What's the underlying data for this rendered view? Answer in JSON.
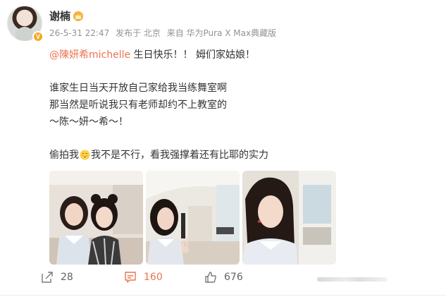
{
  "author": {
    "name": "谢楠",
    "avatar_icon": "avatar-photo",
    "badge_icon": "verified-icon",
    "badge_text": "V",
    "crown_icon": "crown-icon"
  },
  "meta": {
    "time": "26-5-31 22:47",
    "location": "发布于 北京",
    "source": "来自 华为Pura X Max典藏版"
  },
  "content": {
    "line1_mention": "@陳妍希michelle",
    "line1_text": " 生日快乐！！ 姆们家姑娘！",
    "line2": "谁家生日当天开放自己家给我当练舞室啊",
    "line3": "那当然是听说我只有老师却约不上教室的",
    "line4": "～陈～妍～希～！",
    "line5_a": "偷拍我",
    "line5_emoji": "shy-face-emoji",
    "line5_b": "我不是不行，看我强撑着还有比耶的实力"
  },
  "photos": [
    {
      "name": "photo-1",
      "alt": "two women posing in room"
    },
    {
      "name": "photo-2",
      "alt": "woman making peace sign"
    },
    {
      "name": "photo-3",
      "alt": "woman in mirror"
    }
  ],
  "actions": {
    "share_count": "28",
    "comment_count": "160",
    "like_count": "676"
  },
  "colors": {
    "accent": "#eb7350",
    "text": "#333333",
    "meta": "#939393"
  }
}
